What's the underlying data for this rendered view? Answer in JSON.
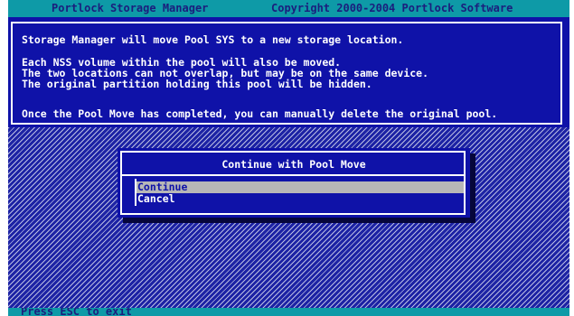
{
  "title_bar": {
    "app_name": "Portlock Storage Manager",
    "copyright": "Copyright 2000-2004 Portlock Software"
  },
  "info": {
    "lines": [
      "Storage Manager will move Pool SYS to a new storage location.",
      "Each NSS volume within the pool will also be moved.",
      "The two locations can not overlap, but may be on the same device.",
      "The original partition holding this pool will be hidden.",
      "Once the Pool Move has completed, you can manually delete the original pool."
    ]
  },
  "dialog": {
    "title": "Continue with Pool Move",
    "options": [
      {
        "label": "Continue",
        "selected": true
      },
      {
        "label": "Cancel",
        "selected": false
      }
    ]
  },
  "status_bar": {
    "text": "Press ESC to exit"
  },
  "colors": {
    "screen_blue": "#1c22a4",
    "panel_blue": "#0f12a8",
    "title_teal": "#0e9aa7",
    "title_text": "#1b1e7d",
    "highlight_gray": "#b7b7b7"
  }
}
